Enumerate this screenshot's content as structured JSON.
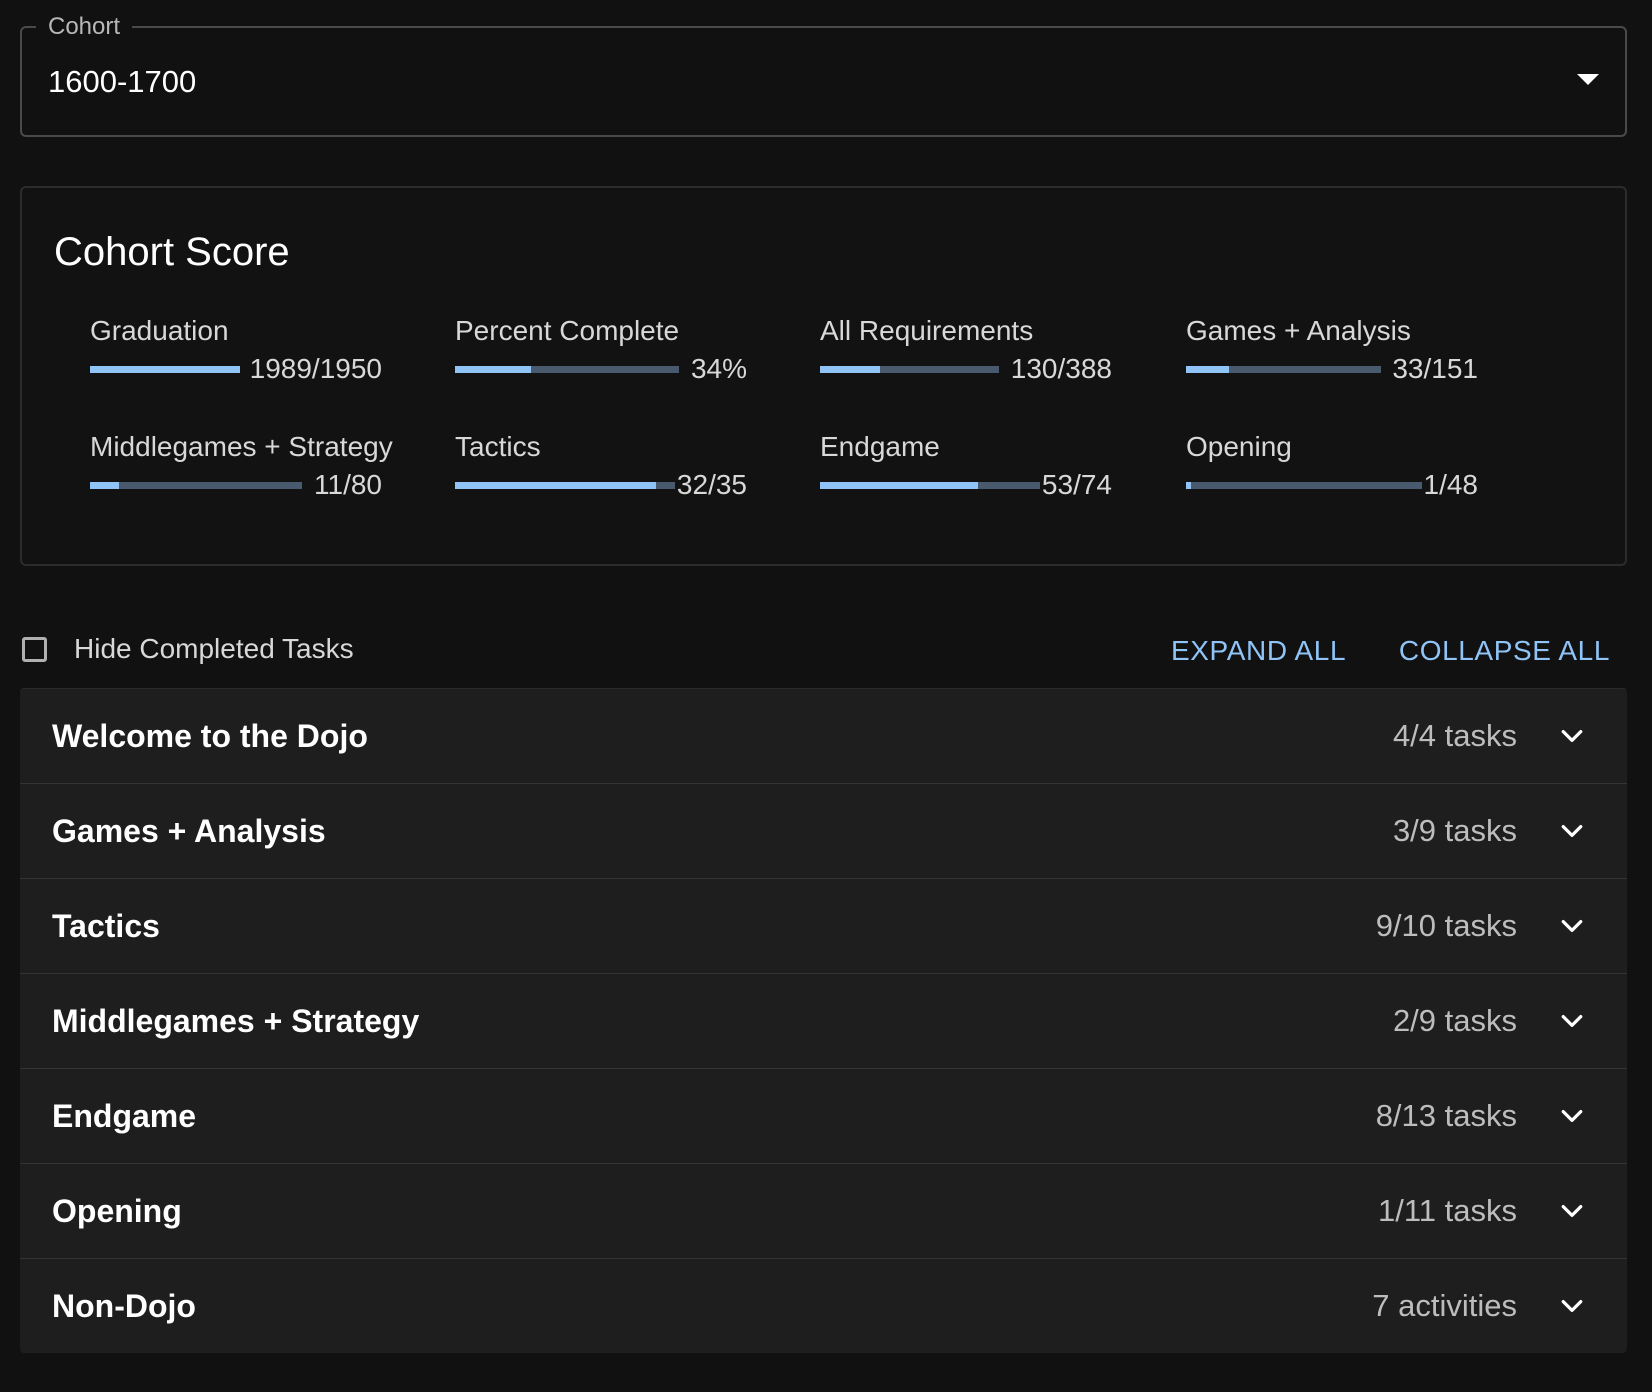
{
  "cohort": {
    "label": "Cohort",
    "value": "1600-1700"
  },
  "score": {
    "title": "Cohort Score",
    "stats": [
      {
        "label": "Graduation",
        "value": "1989/1950",
        "progress": 1.0
      },
      {
        "label": "Percent Complete",
        "value": "34%",
        "progress": 0.34
      },
      {
        "label": "All Requirements",
        "value": "130/388",
        "progress": 0.335
      },
      {
        "label": "Games + Analysis",
        "value": "33/151",
        "progress": 0.219
      },
      {
        "label": "Middlegames + Strategy",
        "value": "11/80",
        "progress": 0.1375
      },
      {
        "label": "Tactics",
        "value": "32/35",
        "progress": 0.914
      },
      {
        "label": "Endgame",
        "value": "53/74",
        "progress": 0.716
      },
      {
        "label": "Opening",
        "value": "1/48",
        "progress": 0.021
      }
    ]
  },
  "controls": {
    "hide_completed_label": "Hide Completed Tasks",
    "hide_completed_checked": false,
    "expand_all_label": "EXPAND ALL",
    "collapse_all_label": "COLLAPSE ALL"
  },
  "sections": [
    {
      "title": "Welcome to the Dojo",
      "count": "4/4 tasks"
    },
    {
      "title": "Games + Analysis",
      "count": "3/9 tasks"
    },
    {
      "title": "Tactics",
      "count": "9/10 tasks"
    },
    {
      "title": "Middlegames + Strategy",
      "count": "2/9 tasks"
    },
    {
      "title": "Endgame",
      "count": "8/13 tasks"
    },
    {
      "title": "Opening",
      "count": "1/11 tasks"
    },
    {
      "title": "Non-Dojo",
      "count": "7 activities"
    }
  ],
  "colors": {
    "accent": "#90c4f7",
    "track": "#4a5a6e",
    "background": "#111111",
    "row_background": "#1e1e1e"
  },
  "icons": {
    "cohort_dropdown": "caret-down-icon",
    "section_toggle": "chevron-down-icon"
  }
}
